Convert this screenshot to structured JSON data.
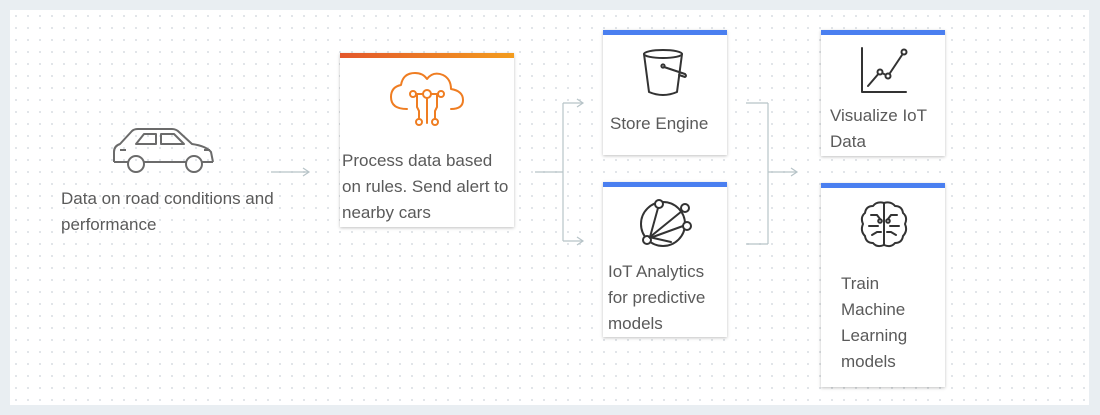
{
  "diagram": {
    "source": {
      "label": "Data on road conditions and performance",
      "icon": "car-icon"
    },
    "process": {
      "label": "Process data based on rules. Send alert to nearby cars",
      "icon": "iot-rules-cloud-icon",
      "accent_colors": [
        "#e3572b",
        "#f39c1e"
      ]
    },
    "store": {
      "label": "Store Engine",
      "icon": "s3-bucket-icon",
      "accent_color": "#4a7ff0"
    },
    "analytics": {
      "label": "IoT Analytics for predictive models",
      "icon": "iot-analytics-icon",
      "accent_color": "#4a7ff0"
    },
    "visualize": {
      "label": "Visualize IoT Data",
      "icon": "chart-icon",
      "accent_color": "#4a7ff0"
    },
    "train": {
      "label": "Train Machine Learning models",
      "icon": "brain-icon",
      "accent_color": "#4a7ff0"
    }
  }
}
